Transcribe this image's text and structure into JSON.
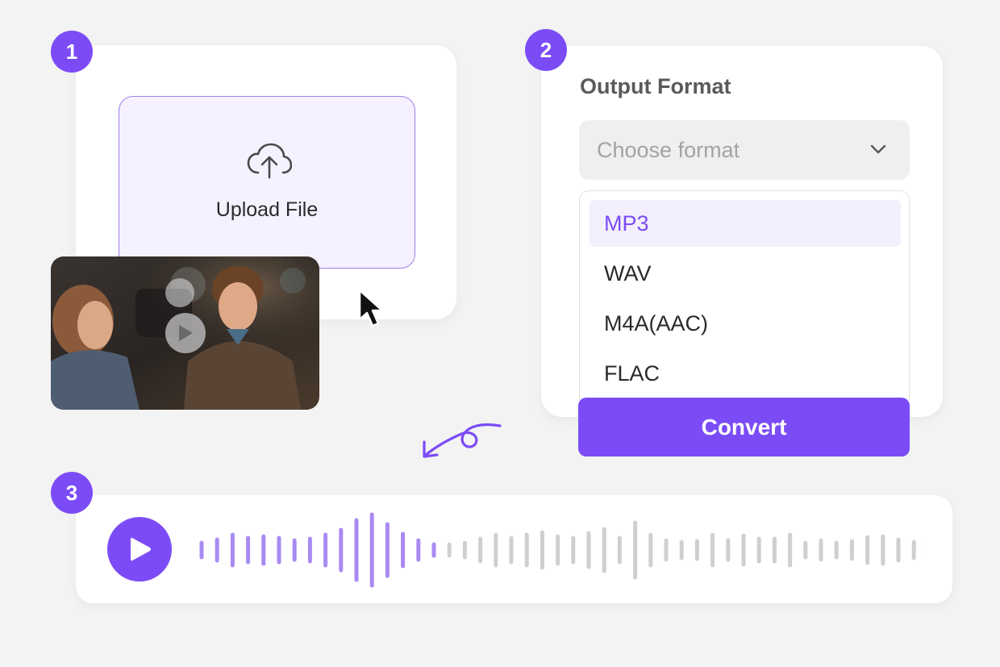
{
  "steps": {
    "one": "1",
    "two": "2",
    "three": "3"
  },
  "upload": {
    "label": "Upload File",
    "icon": "cloud-upload-icon"
  },
  "video": {
    "icon": "play-icon"
  },
  "format": {
    "title": "Output Format",
    "placeholder": "Choose format",
    "icon": "chevron-down-icon",
    "options": [
      "MP3",
      "WAV",
      "M4A(AAC)",
      "FLAC"
    ],
    "selected": "MP3"
  },
  "convert": {
    "label": "Convert"
  },
  "player": {
    "icon": "play-icon",
    "progress": 0.3
  },
  "colors": {
    "accent": "#7b4cf6",
    "accent_light": "#a98af3",
    "wave_inactive": "#cfcfcf",
    "background": "#f3f3f4"
  }
}
